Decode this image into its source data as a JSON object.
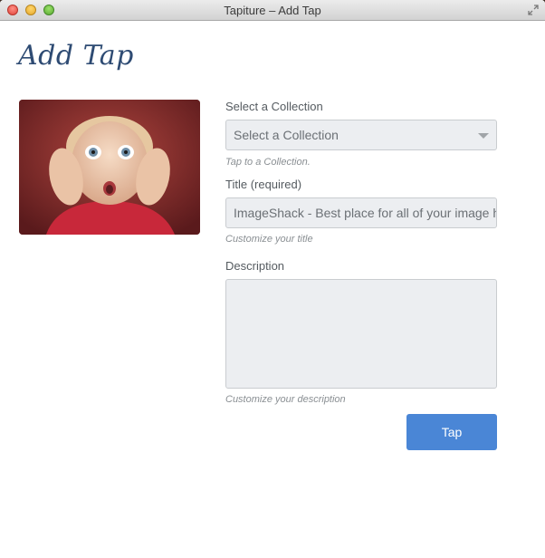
{
  "window": {
    "title": "Tapiture – Add Tap"
  },
  "page": {
    "heading": "Add Tap"
  },
  "thumbnail": {
    "description": "photo of a surprised child"
  },
  "form": {
    "collection": {
      "label": "Select a Collection",
      "selected": "Select a Collection",
      "hint": "Tap to a Collection."
    },
    "title": {
      "label": "Title (required)",
      "value": "ImageShack - Best place for all of your image hosting and image sharing needs",
      "hint": "Customize your title"
    },
    "description": {
      "label": "Description",
      "value": "",
      "hint": "Customize your description"
    },
    "submit_label": "Tap"
  },
  "colors": {
    "accent": "#4a86d6",
    "heading": "#2e4b73",
    "field_bg": "#eceef1"
  }
}
